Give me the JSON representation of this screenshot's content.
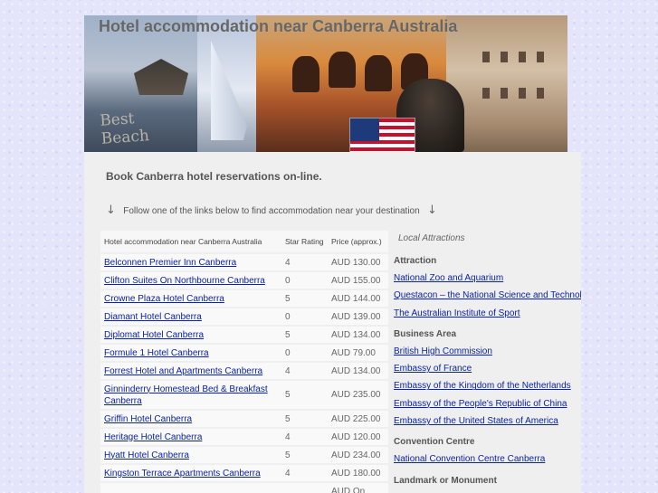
{
  "banner": {
    "title": "Hotel accommodation near Canberra Australia",
    "beach_text_1": "Best",
    "beach_text_2": "Beach"
  },
  "headline": "Book Canberra hotel reservations on-line.",
  "instruction": {
    "text": "Follow one of the links below to find accommodation near your destination",
    "arrow": "↓"
  },
  "table": {
    "headers": [
      "Hotel accommodation near Canberra Australia",
      "Star Rating",
      "Price (approx.)"
    ],
    "rows": [
      {
        "name": "Belconnen Premier Inn Canberra",
        "stars": "4",
        "price": "AUD 130.00"
      },
      {
        "name": "Clifton Suites On Northbourne Canberra",
        "stars": "0",
        "price": "AUD 155.00"
      },
      {
        "name": "Crowne Plaza Hotel Canberra",
        "stars": "5",
        "price": "AUD 144.00"
      },
      {
        "name": "Diamant Hotel Canberra",
        "stars": "0",
        "price": "AUD 139.00"
      },
      {
        "name": "Diplomat Hotel Canberra",
        "stars": "5",
        "price": "AUD 134.00"
      },
      {
        "name": "Formule 1 Hotel Canberra",
        "stars": "0",
        "price": "AUD 79.00"
      },
      {
        "name": "Forrest Hotel and Apartments Canberra",
        "stars": "4",
        "price": "AUD 134.00"
      },
      {
        "name": "Ginninderry Homestead Bed & Breakfast Canberra",
        "stars": "5",
        "price": "AUD 235.00"
      },
      {
        "name": "Griffin Hotel Canberra",
        "stars": "5",
        "price": "AUD 225.00"
      },
      {
        "name": "Heritage Hotel Canberra",
        "stars": "4",
        "price": "AUD 120.00"
      },
      {
        "name": "Hyatt Hotel Canberra",
        "stars": "5",
        "price": "AUD 234.00"
      },
      {
        "name": "Kingston Terrace Apartments Canberra",
        "stars": "4",
        "price": "AUD 180.00"
      },
      {
        "name": "",
        "stars": "",
        "price": "AUD On"
      }
    ]
  },
  "sidebar": {
    "title": "Local Attractions",
    "sections": [
      {
        "heading": "Attraction",
        "links": [
          "National Zoo and Aquarium",
          "Questacon – the National Science and Technology Ce",
          "The Australian Institute of Sport"
        ]
      },
      {
        "heading": "Business Area",
        "links": [
          "British High Commission",
          "Embassy of France",
          "Embassy of the Kingdom of the Netherlands",
          "Embassy of the People's Republic of China",
          "Embassy of the United States of America"
        ]
      },
      {
        "heading": "Convention Centre",
        "links": [
          "National Convention Centre Canberra"
        ]
      },
      {
        "heading": "Landmark or Monument",
        "links": []
      }
    ]
  },
  "colors": {
    "link": "#0a23a8",
    "panel": "#efefef",
    "page_background": "#e4e4fa"
  }
}
